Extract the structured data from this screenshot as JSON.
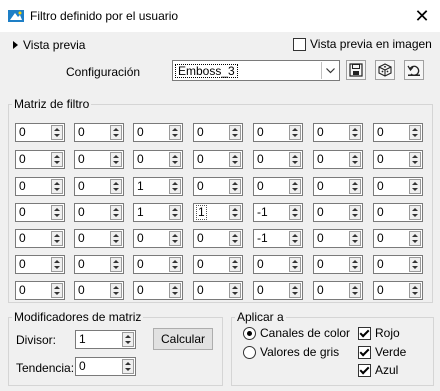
{
  "window": {
    "title": "Filtro definido por el usuario",
    "close_label": "✕"
  },
  "preview": {
    "label": "Vista previa",
    "image_preview_label": "Vista previa en imagen",
    "image_preview_checked": false
  },
  "config": {
    "label": "Configuración",
    "value": "Emboss_3"
  },
  "matrix": {
    "legend": "Matriz de filtro",
    "rows": [
      [
        "0",
        "0",
        "0",
        "0",
        "0",
        "0",
        "0"
      ],
      [
        "0",
        "0",
        "0",
        "0",
        "0",
        "0",
        "0"
      ],
      [
        "0",
        "0",
        "1",
        "0",
        "0",
        "0",
        "0"
      ],
      [
        "0",
        "0",
        "1",
        "1",
        "-1",
        "0",
        "0"
      ],
      [
        "0",
        "0",
        "0",
        "0",
        "-1",
        "0",
        "0"
      ],
      [
        "0",
        "0",
        "0",
        "0",
        "0",
        "0",
        "0"
      ],
      [
        "0",
        "0",
        "0",
        "0",
        "0",
        "0",
        "0"
      ]
    ]
  },
  "modifiers": {
    "legend": "Modificadores de matriz",
    "divisor_label": "Divisor:",
    "divisor_value": "1",
    "bias_label": "Tendencia:",
    "bias_value": "0",
    "calc_label": "Calcular"
  },
  "apply": {
    "legend": "Aplicar a",
    "color_channels": "Canales de color",
    "gray_values": "Valores de gris",
    "selected": "color_channels",
    "red": "Rojo",
    "green": "Verde",
    "blue": "Azul",
    "red_checked": true,
    "green_checked": true,
    "blue_checked": true
  },
  "icons": {
    "app": "filter-app-icon",
    "save": "save-icon",
    "load": "cube-icon",
    "reset": "reset-icon"
  }
}
